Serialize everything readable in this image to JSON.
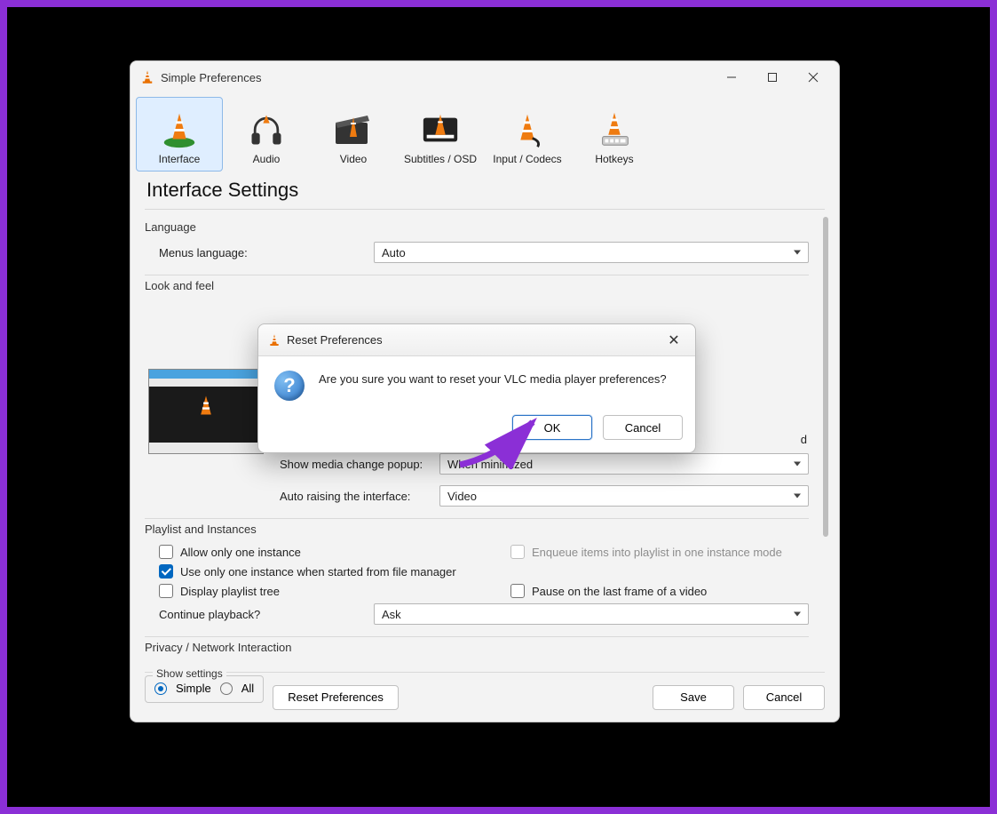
{
  "window": {
    "title": "Simple Preferences"
  },
  "toolbar": {
    "items": [
      {
        "label": "Interface",
        "selected": true
      },
      {
        "label": "Audio",
        "selected": false
      },
      {
        "label": "Video",
        "selected": false
      },
      {
        "label": "Subtitles / OSD",
        "selected": false
      },
      {
        "label": "Input / Codecs",
        "selected": false
      },
      {
        "label": "Hotkeys",
        "selected": false
      }
    ]
  },
  "page": {
    "heading": "Interface Settings"
  },
  "language": {
    "legend": "Language",
    "menus_label": "Menus language:",
    "value": "Auto"
  },
  "look": {
    "legend": "Look and feel",
    "popup_label": "Show media change popup:",
    "popup_value": "When minimized",
    "raise_label": "Auto raising the interface:",
    "raise_value": "Video",
    "partial_label_suffix": "d"
  },
  "playlist": {
    "legend": "Playlist and Instances",
    "allow_one": "Allow only one instance",
    "enqueue": "Enqueue items into playlist in one instance mode",
    "use_one_fm": "Use only one instance when started from file manager",
    "display_tree": "Display playlist tree",
    "pause_last": "Pause on the last frame of a video",
    "continue_label": "Continue playback?",
    "continue_value": "Ask"
  },
  "privacy": {
    "legend": "Privacy / Network Interaction"
  },
  "show_settings": {
    "legend": "Show settings",
    "simple": "Simple",
    "all": "All"
  },
  "buttons": {
    "reset": "Reset Preferences",
    "save": "Save",
    "cancel": "Cancel"
  },
  "modal": {
    "title": "Reset Preferences",
    "message": "Are you sure you want to reset your VLC media player preferences?",
    "ok": "OK",
    "cancel": "Cancel"
  }
}
